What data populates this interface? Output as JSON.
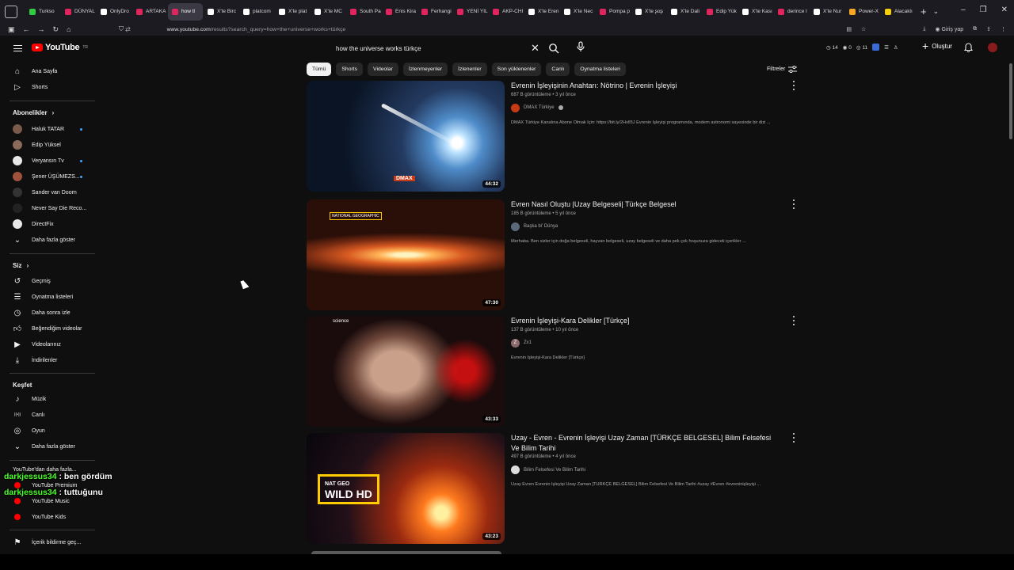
{
  "browser": {
    "tabs": [
      {
        "label": "Turkso",
        "color": "#2ecc40"
      },
      {
        "label": "DÜNYAL",
        "color": "#e0245e"
      },
      {
        "label": "OnlyDro",
        "color": "#ffffff"
      },
      {
        "label": "ARTAKA",
        "color": "#e0245e"
      },
      {
        "label": "how tl",
        "color": "#e0245e",
        "active": true
      },
      {
        "label": "X'te Birc",
        "color": "#ffffff"
      },
      {
        "label": "platcom",
        "color": "#ffffff"
      },
      {
        "label": "X'te plat",
        "color": "#ffffff"
      },
      {
        "label": "X'te MC",
        "color": "#ffffff"
      },
      {
        "label": "South Pa",
        "color": "#e0245e"
      },
      {
        "label": "Enis Kira",
        "color": "#e0245e"
      },
      {
        "label": "Ferhangi",
        "color": "#e0245e"
      },
      {
        "label": "YENİ YIL",
        "color": "#e0245e"
      },
      {
        "label": "AKP-CHI",
        "color": "#e0245e"
      },
      {
        "label": "X'te Eren",
        "color": "#ffffff"
      },
      {
        "label": "X'te Nec",
        "color": "#ffffff"
      },
      {
        "label": "Pompa p",
        "color": "#e0245e"
      },
      {
        "label": "X'te ʂαʂ",
        "color": "#ffffff"
      },
      {
        "label": "X'te Dali",
        "color": "#ffffff"
      },
      {
        "label": "Edip Yük",
        "color": "#e0245e"
      },
      {
        "label": "X'te Kası",
        "color": "#ffffff"
      },
      {
        "label": "derince l",
        "color": "#e0245e"
      },
      {
        "label": "X'te Nur",
        "color": "#ffffff"
      },
      {
        "label": "Power-X",
        "color": "#f5a623"
      },
      {
        "label": "Alacaklı",
        "color": "#f5d000"
      }
    ],
    "url_host": "www.youtube.com",
    "url_path": "/results?search_query=how+the+universe+works+türkçe",
    "signin_label": "Giriş yap"
  },
  "header": {
    "logo_text": "YouTube",
    "logo_region": "TR",
    "search_value": "how the universe works türkçe",
    "stats": [
      "14",
      "0",
      "11"
    ],
    "create_label": "Oluştur"
  },
  "sidebar": {
    "main": [
      {
        "label": "Ana Sayfa",
        "icon": "home-icon"
      },
      {
        "label": "Shorts",
        "icon": "shorts-icon"
      }
    ],
    "subs_title": "Abonelikler",
    "subs": [
      {
        "label": "Haluk TATAR",
        "color": "#7a5a4a",
        "dot": true
      },
      {
        "label": "Edip Yüksel",
        "color": "#8a6a5a",
        "dot": false
      },
      {
        "label": "Veryansın Tv",
        "color": "#e8e8e8",
        "dot": true
      },
      {
        "label": "Şener ÜŞÜMEZS...",
        "color": "#a0523d",
        "dot": true
      },
      {
        "label": "Sander van Doorn",
        "color": "#333333",
        "dot": false
      },
      {
        "label": "Never Say Die Reco...",
        "color": "#222222",
        "dot": false
      },
      {
        "label": "DirectFix",
        "color": "#e8e8e8",
        "dot": false
      }
    ],
    "subs_more": "Daha fazla göster",
    "you_title": "Siz",
    "you": [
      {
        "label": "Geçmiş",
        "icon": "history-icon"
      },
      {
        "label": "Oynatma listeleri",
        "icon": "playlists-icon"
      },
      {
        "label": "Daha sonra izle",
        "icon": "watch-later-icon"
      },
      {
        "label": "Beğendiğim videolar",
        "icon": "like-icon"
      },
      {
        "label": "Videolarınız",
        "icon": "your-videos-icon"
      },
      {
        "label": "İndirilenler",
        "icon": "download-icon"
      }
    ],
    "explore_title": "Keşfet",
    "explore": [
      {
        "label": "Müzik",
        "icon": "music-icon"
      },
      {
        "label": "Canlı",
        "icon": "live-icon"
      },
      {
        "label": "Oyun",
        "icon": "gaming-icon"
      }
    ],
    "explore_more": "Daha fazla göster",
    "more_title": "YouTube'dan daha fazla...",
    "more": [
      {
        "label": "YouTube Premium"
      },
      {
        "label": "YouTube Music"
      },
      {
        "label": "YouTube Kids"
      }
    ],
    "report_label": "İçerik bildirme geç..."
  },
  "chips": [
    "Tümü",
    "Shorts",
    "Videolar",
    "İzlenmeyenler",
    "İzlenenler",
    "Son yüklenenler",
    "Canlı",
    "Oynatma listeleri"
  ],
  "filters_label": "Filtreler",
  "results": [
    {
      "title": "Evrenin İşleyişinin Anahtarı: Nötrino | Evrenin İşleyişi",
      "meta": "687 B görüntüleme • 3 yıl önce",
      "channel": "DMAX Türkiye",
      "channel_color": "#c73a16",
      "verified": true,
      "desc": "DMAX Türkiye Kanalına Abone Olmak İçin: https://bit.ly/2HvlI5J Evrenin İşleyişi programında, modern astronomi sayesinde bir dizi ...",
      "duration": "44:32",
      "thumb_text": "DMAX"
    },
    {
      "title": "Evren Nasıl Oluştu |Uzay Belgeseli| Türkçe Belgesel",
      "meta": "185 B görüntüleme • 5 yıl önce",
      "channel": "Başka bi' Dünya",
      "channel_color": "#5a6a7a",
      "verified": false,
      "desc": "Merhaba. Ben sizler için doğa belgeseli, hayvan belgeseli, uzay belgeseli ve daha pek çok hoşunuza gidecek içerikler ...",
      "duration": "47:30",
      "thumb_text": "NATIONAL GEOGRAPHIC"
    },
    {
      "title": "Evrenin İşleyişi-Kara Delikler [Türkçe]",
      "meta": "137 B görüntüleme • 10 yıl önce",
      "channel": "Zx1",
      "channel_color": "#8a6a6a",
      "channel_initial": "Z",
      "verified": false,
      "desc": "Evrenin İşleyişi-Kara Delikler [Türkçe]",
      "duration": "43:33",
      "thumb_text": "science"
    },
    {
      "title": "Uzay - Evren - Evrenin İşleyişi Uzay Zaman [TÜRKÇE BELGESEL] Bilim Felsefesi Ve Bilim Tarihi",
      "meta": "497 B görüntüleme • 4 yıl önce",
      "channel": "Bilim Felsefesi Ve Bilim Tarihi",
      "channel_color": "#dddddd",
      "verified": false,
      "desc": "Uzay Evren Evrenin İşleyişi Uzay Zaman [TÜRKÇE BELGESEL] Bilim Felsefesi Ve Bilim Tarihi #uzay #Evren #evreninişleyişi ...",
      "duration": "43:23",
      "thumb_text_top": "NAT GEO",
      "thumb_text": "WILD HD"
    }
  ],
  "chat": [
    {
      "user": "darkjessus34",
      "msg": " : ben gördüm"
    },
    {
      "user": "darkjessus34",
      "msg": " : tuttuğunu"
    }
  ]
}
